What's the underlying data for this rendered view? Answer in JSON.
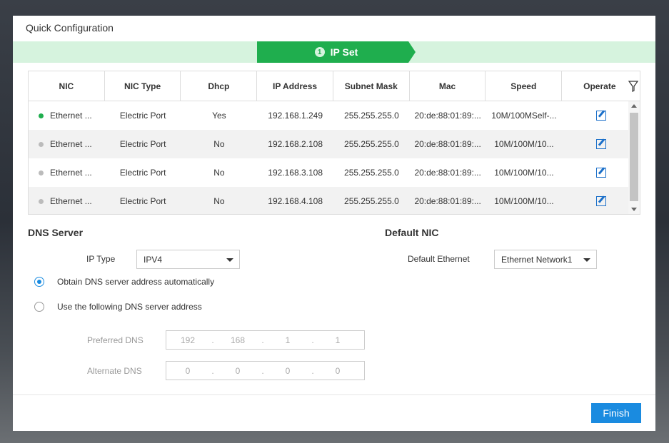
{
  "dialog": {
    "title": "Quick Configuration"
  },
  "step": {
    "number": "1",
    "label": "IP Set"
  },
  "table": {
    "headers": [
      "NIC",
      "NIC Type",
      "Dhcp",
      "IP Address",
      "Subnet Mask",
      "Mac",
      "Speed",
      "Operate"
    ],
    "rows": [
      {
        "nic": "Ethernet ...",
        "type": "Electric Port",
        "dhcp": "Yes",
        "ip": "192.168.1.249",
        "mask": "255.255.255.0",
        "mac": "20:de:88:01:89:...",
        "speed": "10M/100MSelf-...",
        "active": true
      },
      {
        "nic": "Ethernet ...",
        "type": "Electric Port",
        "dhcp": "No",
        "ip": "192.168.2.108",
        "mask": "255.255.255.0",
        "mac": "20:de:88:01:89:...",
        "speed": "10M/100M/10...",
        "active": false
      },
      {
        "nic": "Ethernet ...",
        "type": "Electric Port",
        "dhcp": "No",
        "ip": "192.168.3.108",
        "mask": "255.255.255.0",
        "mac": "20:de:88:01:89:...",
        "speed": "10M/100M/10...",
        "active": false
      },
      {
        "nic": "Ethernet ...",
        "type": "Electric Port",
        "dhcp": "No",
        "ip": "192.168.4.108",
        "mask": "255.255.255.0",
        "mac": "20:de:88:01:89:...",
        "speed": "10M/100M/10...",
        "active": false
      }
    ]
  },
  "dns": {
    "title": "DNS Server",
    "ip_type_label": "IP Type",
    "ip_type_value": "IPV4",
    "auto_label": "Obtain DNS server address automatically",
    "manual_label": "Use the following DNS server address",
    "selected": "auto",
    "preferred_label": "Preferred DNS",
    "preferred": [
      "192",
      "168",
      "1",
      "1"
    ],
    "alternate_label": "Alternate DNS",
    "alternate": [
      "0",
      "0",
      "0",
      "0"
    ]
  },
  "default_nic": {
    "title": "Default NIC",
    "label": "Default Ethernet",
    "value": "Ethernet Network1"
  },
  "footer": {
    "finish_label": "Finish"
  },
  "colors": {
    "accent": "#1a8be0",
    "step_green": "#1fae4e",
    "step_bar": "#d6f3de",
    "active_dot": "#1fae4e"
  }
}
